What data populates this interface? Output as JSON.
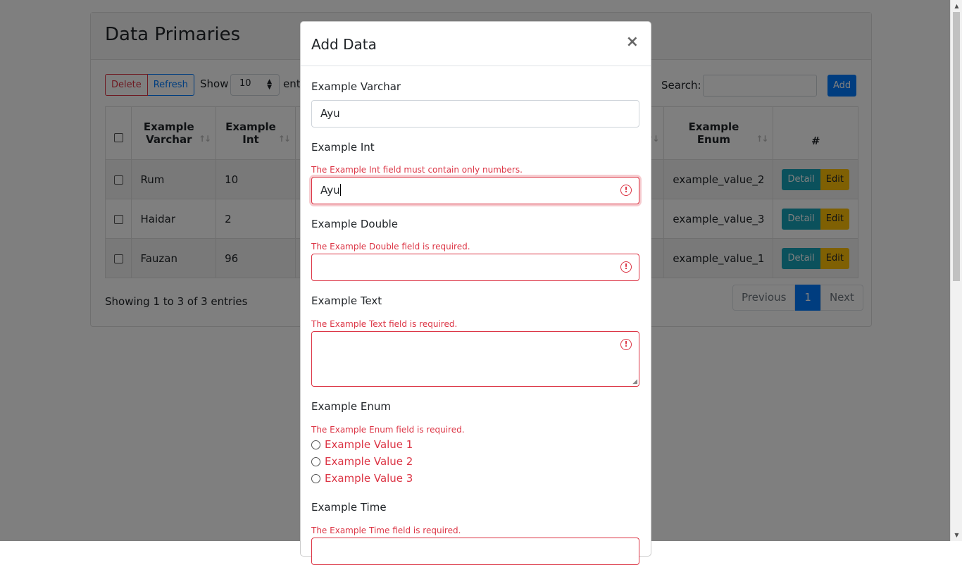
{
  "page": {
    "title": "Data Primaries",
    "buttons": {
      "delete": "Delete",
      "refresh": "Refresh",
      "add": "Add"
    },
    "length_menu": {
      "prefix": "Show",
      "value": "10",
      "suffix": "entri"
    },
    "search": {
      "label": "Search:",
      "value": ""
    },
    "table": {
      "headers": [
        {
          "line1": "Example",
          "line2": "Varchar"
        },
        {
          "line1": "Example",
          "line2": "Int"
        },
        {
          "line1": "Example",
          "line2": "Enum"
        },
        {
          "line1": "#",
          "line2": ""
        }
      ],
      "rows": [
        {
          "varchar": "Rum",
          "int": "10",
          "enum": "example_value_2"
        },
        {
          "varchar": "Haidar",
          "int": "2",
          "enum": "example_value_3"
        },
        {
          "varchar": "Fauzan",
          "int": "96",
          "enum": "example_value_1"
        }
      ],
      "row_buttons": {
        "detail": "Detail",
        "edit": "Edit"
      }
    },
    "info": "Showing 1 to 3 of 3 entries",
    "pagination": {
      "previous": "Previous",
      "current": "1",
      "next": "Next"
    }
  },
  "modal": {
    "title": "Add Data",
    "close": "×",
    "fields": {
      "varchar": {
        "label": "Example Varchar",
        "value": "Ayu"
      },
      "int": {
        "label": "Example Int",
        "error": "The Example Int field must contain only numbers.",
        "value": "Ayu"
      },
      "double": {
        "label": "Example Double",
        "error": "The Example Double field is required.",
        "value": ""
      },
      "text": {
        "label": "Example Text",
        "error": "The Example Text field is required.",
        "value": ""
      },
      "enum": {
        "label": "Example Enum",
        "error": "The Example Enum field is required.",
        "options": [
          "Example Value 1",
          "Example Value 2",
          "Example Value 3"
        ]
      },
      "time": {
        "label": "Example Time",
        "error": "The Example Time field is required."
      }
    }
  },
  "icons": {
    "error": "!",
    "sort": "↑↓",
    "close": "×"
  },
  "colors": {
    "primary": "#007bff",
    "danger": "#dc3545",
    "info": "#17a2b8",
    "warning": "#ffc107"
  }
}
